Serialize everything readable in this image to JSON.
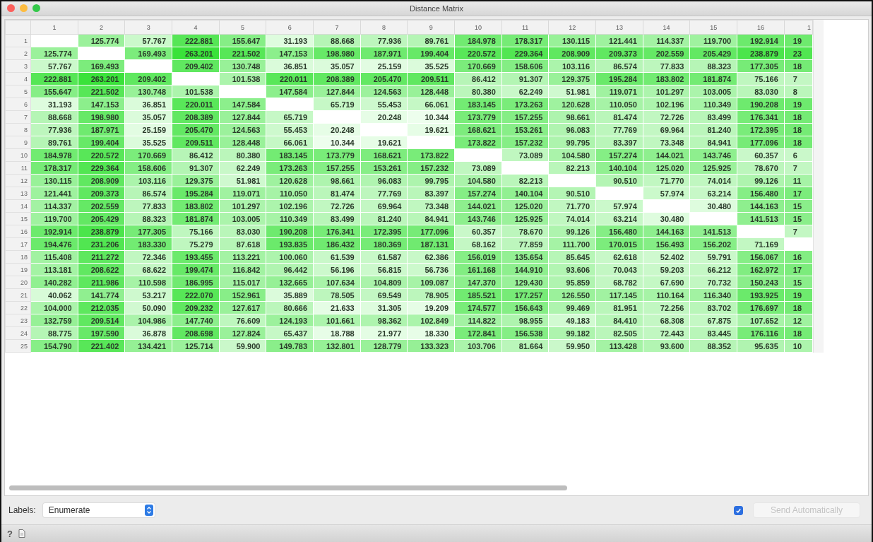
{
  "window": {
    "title": "Distance Matrix"
  },
  "matrix": {
    "columns": [
      "1",
      "2",
      "3",
      "4",
      "5",
      "6",
      "7",
      "8",
      "9",
      "10",
      "11",
      "12",
      "13",
      "14",
      "15",
      "16",
      "1"
    ],
    "rows": [
      {
        "label": "1",
        "cells": [
          null,
          "125.774",
          "57.767",
          "222.881",
          "155.647",
          "31.193",
          "88.668",
          "77.936",
          "89.761",
          "184.978",
          "178.317",
          "130.115",
          "121.441",
          "114.337",
          "119.700",
          "192.914",
          "19"
        ]
      },
      {
        "label": "2",
        "cells": [
          "125.774",
          null,
          "169.493",
          "263.201",
          "221.502",
          "147.153",
          "198.980",
          "187.971",
          "199.404",
          "220.572",
          "229.364",
          "208.909",
          "209.373",
          "202.559",
          "205.429",
          "238.879",
          "23"
        ]
      },
      {
        "label": "3",
        "cells": [
          "57.767",
          "169.493",
          null,
          "209.402",
          "130.748",
          "36.851",
          "35.057",
          "25.159",
          "35.525",
          "170.669",
          "158.606",
          "103.116",
          "86.574",
          "77.833",
          "88.323",
          "177.305",
          "18"
        ]
      },
      {
        "label": "4",
        "cells": [
          "222.881",
          "263.201",
          "209.402",
          null,
          "101.538",
          "220.011",
          "208.389",
          "205.470",
          "209.511",
          "86.412",
          "91.307",
          "129.375",
          "195.284",
          "183.802",
          "181.874",
          "75.166",
          "7"
        ]
      },
      {
        "label": "5",
        "cells": [
          "155.647",
          "221.502",
          "130.748",
          "101.538",
          null,
          "147.584",
          "127.844",
          "124.563",
          "128.448",
          "80.380",
          "62.249",
          "51.981",
          "119.071",
          "101.297",
          "103.005",
          "83.030",
          "8"
        ]
      },
      {
        "label": "6",
        "cells": [
          "31.193",
          "147.153",
          "36.851",
          "220.011",
          "147.584",
          null,
          "65.719",
          "55.453",
          "66.061",
          "183.145",
          "173.263",
          "120.628",
          "110.050",
          "102.196",
          "110.349",
          "190.208",
          "19"
        ]
      },
      {
        "label": "7",
        "cells": [
          "88.668",
          "198.980",
          "35.057",
          "208.389",
          "127.844",
          "65.719",
          null,
          "20.248",
          "10.344",
          "173.779",
          "157.255",
          "98.661",
          "81.474",
          "72.726",
          "83.499",
          "176.341",
          "18"
        ]
      },
      {
        "label": "8",
        "cells": [
          "77.936",
          "187.971",
          "25.159",
          "205.470",
          "124.563",
          "55.453",
          "20.248",
          null,
          "19.621",
          "168.621",
          "153.261",
          "96.083",
          "77.769",
          "69.964",
          "81.240",
          "172.395",
          "18"
        ]
      },
      {
        "label": "9",
        "cells": [
          "89.761",
          "199.404",
          "35.525",
          "209.511",
          "128.448",
          "66.061",
          "10.344",
          "19.621",
          null,
          "173.822",
          "157.232",
          "99.795",
          "83.397",
          "73.348",
          "84.941",
          "177.096",
          "18"
        ]
      },
      {
        "label": "10",
        "cells": [
          "184.978",
          "220.572",
          "170.669",
          "86.412",
          "80.380",
          "183.145",
          "173.779",
          "168.621",
          "173.822",
          null,
          "73.089",
          "104.580",
          "157.274",
          "144.021",
          "143.746",
          "60.357",
          "6"
        ]
      },
      {
        "label": "11",
        "cells": [
          "178.317",
          "229.364",
          "158.606",
          "91.307",
          "62.249",
          "173.263",
          "157.255",
          "153.261",
          "157.232",
          "73.089",
          null,
          "82.213",
          "140.104",
          "125.020",
          "125.925",
          "78.670",
          "7"
        ]
      },
      {
        "label": "12",
        "cells": [
          "130.115",
          "208.909",
          "103.116",
          "129.375",
          "51.981",
          "120.628",
          "98.661",
          "96.083",
          "99.795",
          "104.580",
          "82.213",
          null,
          "90.510",
          "71.770",
          "74.014",
          "99.126",
          "11"
        ]
      },
      {
        "label": "13",
        "cells": [
          "121.441",
          "209.373",
          "86.574",
          "195.284",
          "119.071",
          "110.050",
          "81.474",
          "77.769",
          "83.397",
          "157.274",
          "140.104",
          "90.510",
          null,
          "57.974",
          "63.214",
          "156.480",
          "17"
        ]
      },
      {
        "label": "14",
        "cells": [
          "114.337",
          "202.559",
          "77.833",
          "183.802",
          "101.297",
          "102.196",
          "72.726",
          "69.964",
          "73.348",
          "144.021",
          "125.020",
          "71.770",
          "57.974",
          null,
          "30.480",
          "144.163",
          "15"
        ]
      },
      {
        "label": "15",
        "cells": [
          "119.700",
          "205.429",
          "88.323",
          "181.874",
          "103.005",
          "110.349",
          "83.499",
          "81.240",
          "84.941",
          "143.746",
          "125.925",
          "74.014",
          "63.214",
          "30.480",
          null,
          "141.513",
          "15"
        ]
      },
      {
        "label": "16",
        "cells": [
          "192.914",
          "238.879",
          "177.305",
          "75.166",
          "83.030",
          "190.208",
          "176.341",
          "172.395",
          "177.096",
          "60.357",
          "78.670",
          "99.126",
          "156.480",
          "144.163",
          "141.513",
          null,
          "7"
        ]
      },
      {
        "label": "17",
        "cells": [
          "194.476",
          "231.206",
          "183.330",
          "75.279",
          "87.618",
          "193.835",
          "186.432",
          "180.369",
          "187.131",
          "68.162",
          "77.859",
          "111.700",
          "170.015",
          "156.493",
          "156.202",
          "71.169",
          null
        ]
      },
      {
        "label": "18",
        "cells": [
          "115.408",
          "211.272",
          "72.346",
          "193.455",
          "113.221",
          "100.060",
          "61.539",
          "61.587",
          "62.386",
          "156.019",
          "135.654",
          "85.645",
          "62.618",
          "52.402",
          "59.791",
          "156.067",
          "16"
        ]
      },
      {
        "label": "19",
        "cells": [
          "113.181",
          "208.622",
          "68.622",
          "199.474",
          "116.842",
          "96.442",
          "56.196",
          "56.815",
          "56.736",
          "161.168",
          "144.910",
          "93.606",
          "70.043",
          "59.203",
          "66.212",
          "162.972",
          "17"
        ]
      },
      {
        "label": "20",
        "cells": [
          "140.282",
          "211.986",
          "110.598",
          "186.995",
          "115.017",
          "132.665",
          "107.634",
          "104.809",
          "109.087",
          "147.370",
          "129.430",
          "95.859",
          "68.782",
          "67.690",
          "70.732",
          "150.243",
          "15"
        ]
      },
      {
        "label": "21",
        "cells": [
          "40.062",
          "141.774",
          "53.217",
          "222.070",
          "152.961",
          "35.889",
          "78.505",
          "69.549",
          "78.905",
          "185.521",
          "177.257",
          "126.550",
          "117.145",
          "110.164",
          "116.340",
          "193.925",
          "19"
        ]
      },
      {
        "label": "22",
        "cells": [
          "104.000",
          "212.035",
          "50.090",
          "209.232",
          "127.617",
          "80.666",
          "21.633",
          "31.305",
          "19.209",
          "174.577",
          "156.643",
          "99.469",
          "81.951",
          "72.256",
          "83.702",
          "176.697",
          "18"
        ]
      },
      {
        "label": "23",
        "cells": [
          "132.759",
          "209.514",
          "104.986",
          "147.740",
          "76.609",
          "124.193",
          "101.661",
          "98.362",
          "102.849",
          "114.822",
          "98.955",
          "49.183",
          "84.410",
          "68.308",
          "67.875",
          "107.652",
          "12"
        ]
      },
      {
        "label": "24",
        "cells": [
          "88.775",
          "197.590",
          "36.878",
          "208.698",
          "127.824",
          "65.437",
          "18.788",
          "21.977",
          "18.330",
          "172.841",
          "156.538",
          "99.182",
          "82.505",
          "72.443",
          "83.445",
          "176.116",
          "18"
        ]
      },
      {
        "label": "25",
        "cells": [
          "154.790",
          "221.402",
          "134.421",
          "125.714",
          "59.900",
          "149.783",
          "132.801",
          "128.779",
          "133.323",
          "103.706",
          "81.664",
          "59.950",
          "113.428",
          "93.600",
          "88.352",
          "95.635",
          "10"
        ]
      }
    ]
  },
  "controls": {
    "labels_label": "Labels:",
    "labels_value": "Enumerate",
    "send_automatically": {
      "checked": true
    },
    "send_button": {
      "label": "Send Automatically",
      "disabled": true
    }
  },
  "status_bar": {
    "help": "?"
  }
}
